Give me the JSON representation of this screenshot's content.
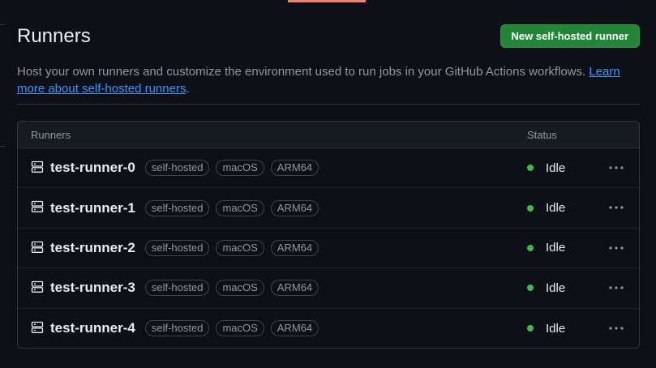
{
  "header": {
    "title": "Runners",
    "new_button_label": "New self-hosted runner"
  },
  "description": {
    "text": "Host your own runners and customize the environment used to run jobs in your GitHub Actions workflows. ",
    "link_text": "Learn more about self-hosted runners",
    "trailing": "."
  },
  "table": {
    "columns": {
      "runners": "Runners",
      "status": "Status"
    },
    "rows": [
      {
        "name": "test-runner-0",
        "labels": [
          "self-hosted",
          "macOS",
          "ARM64"
        ],
        "status": "Idle"
      },
      {
        "name": "test-runner-1",
        "labels": [
          "self-hosted",
          "macOS",
          "ARM64"
        ],
        "status": "Idle"
      },
      {
        "name": "test-runner-2",
        "labels": [
          "self-hosted",
          "macOS",
          "ARM64"
        ],
        "status": "Idle"
      },
      {
        "name": "test-runner-3",
        "labels": [
          "self-hosted",
          "macOS",
          "ARM64"
        ],
        "status": "Idle"
      },
      {
        "name": "test-runner-4",
        "labels": [
          "self-hosted",
          "macOS",
          "ARM64"
        ],
        "status": "Idle"
      }
    ]
  },
  "icons": {
    "runner": "server-icon",
    "menu": "kebab-horizontal-icon",
    "status": "status-dot"
  },
  "colors": {
    "background": "#0d1117",
    "primary_button": "#238636",
    "status_idle": "#3fb950",
    "link": "#4493f8",
    "tab_accent": "#f78166"
  }
}
